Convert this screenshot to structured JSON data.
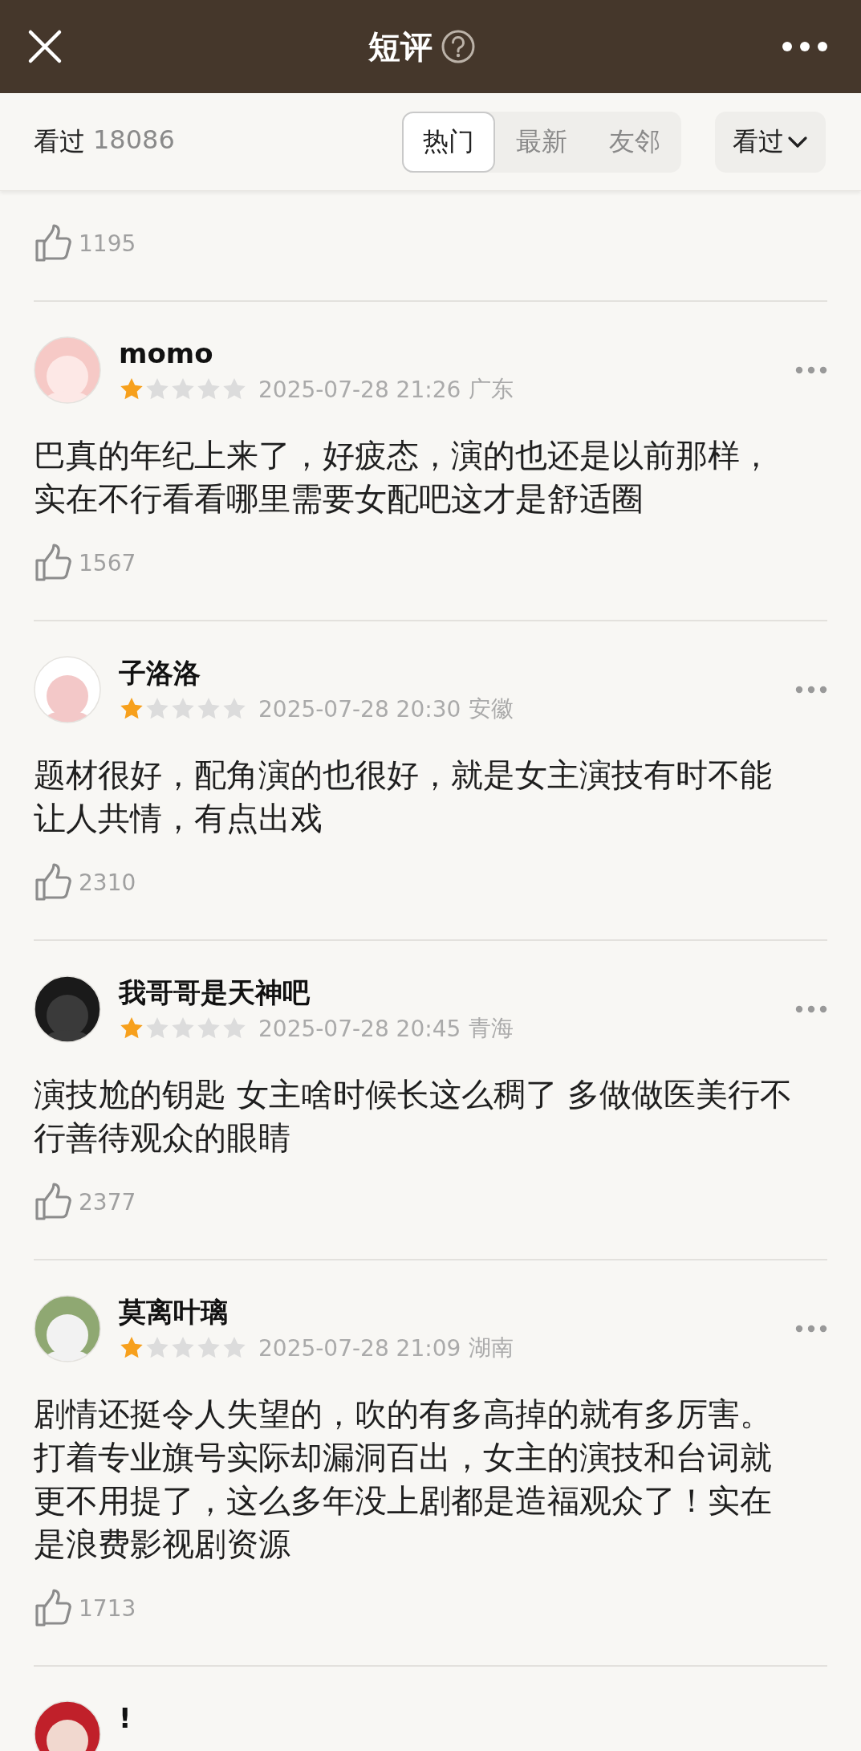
{
  "header": {
    "title": "短评"
  },
  "filter": {
    "watched_label": "看过",
    "watched_count": "18086",
    "tabs": [
      {
        "label": "热门",
        "selected": true
      },
      {
        "label": "最新",
        "selected": false
      },
      {
        "label": "友邻",
        "selected": false
      }
    ],
    "dropdown": "看过"
  },
  "reviews": [
    {
      "kind": "cut_top",
      "likes": "1195"
    },
    {
      "kind": "full",
      "name": "momo",
      "stars": 1,
      "date": "2025-07-28 21:26",
      "location": "广东",
      "text": "巴真的年纪上来了，好疲态，演的也还是以前那样，实在不行看看哪里需要女配吧这才是舒适圈",
      "likes": "1567"
    },
    {
      "kind": "full",
      "name": "子洛洛",
      "stars": 1,
      "date": "2025-07-28 20:30",
      "location": "安徽",
      "text": "题材很好，配角演的也很好，就是女主演技有时不能让人共情，有点出戏",
      "likes": "2310"
    },
    {
      "kind": "full",
      "name": "我哥哥是天神吧",
      "stars": 1,
      "date": "2025-07-28 20:45",
      "location": "青海",
      "text": "演技尬的钥匙 女主啥时候长这么稠了 多做做医美行不行善待观众的眼睛",
      "likes": "2377"
    },
    {
      "kind": "full",
      "name": "莫离叶璃",
      "stars": 1,
      "date": "2025-07-28 21:09",
      "location": "湖南",
      "text": "剧情还挺令人失望的，吹的有多高掉的就有多厉害。打着专业旗号实际却漏洞百出，女主的演技和台词就更不用提了，这么多年没上剧都是造福观众了！实在是浪费影视剧资源",
      "likes": "1713"
    },
    {
      "kind": "cut_bottom",
      "name": "!"
    }
  ]
}
